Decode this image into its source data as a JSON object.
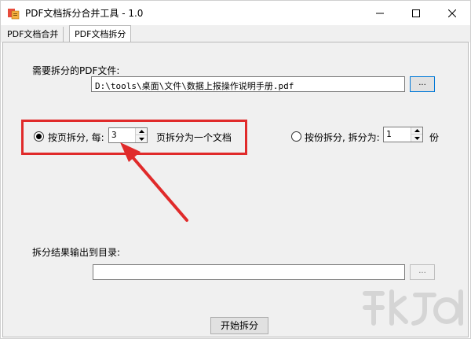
{
  "window": {
    "title": "PDF文档拆分合并工具 - 1.0",
    "controls": {
      "minimize": "minimize-icon",
      "maximize": "maximize-icon",
      "close": "close-icon"
    }
  },
  "tabs": [
    {
      "label": "PDF文档合并",
      "active": false
    },
    {
      "label": "PDF文档拆分",
      "active": true
    }
  ],
  "split": {
    "source_label": "需要拆分的PDF文件:",
    "source_path": "D:\\tools\\桌面\\文件\\数据上报操作说明手册.pdf",
    "browse_label": "...",
    "by_page": {
      "label": "按页拆分, 每:",
      "value": "3",
      "suffix": "页拆分为一个文档",
      "checked": true
    },
    "by_count": {
      "label": "按份拆分, 拆分为:",
      "value": "1",
      "suffix": "份",
      "checked": false
    },
    "output_label": "拆分结果输出到目录:",
    "output_path": "",
    "output_browse_label": "...",
    "start_label": "开始拆分"
  },
  "colors": {
    "highlight": "#e02a2a",
    "accent": "#0078d7"
  }
}
